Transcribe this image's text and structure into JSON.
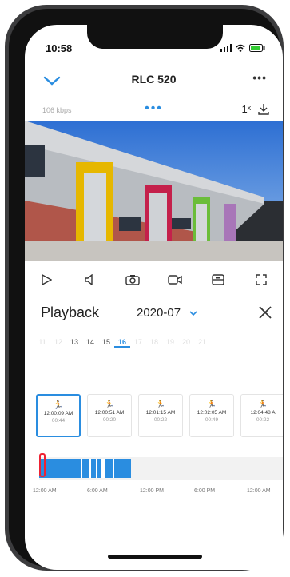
{
  "status": {
    "time": "10:58"
  },
  "header": {
    "title": "RLC 520",
    "more": "•••"
  },
  "subbar": {
    "speed": "106 kbps",
    "ratio": "1ˣ"
  },
  "playback": {
    "title": "Playback",
    "month": "2020-07"
  },
  "days": [
    "11",
    "12",
    "13",
    "14",
    "15",
    "16",
    "17",
    "18",
    "19",
    "20",
    "21"
  ],
  "days_active": [
    "13",
    "14",
    "15",
    "16"
  ],
  "selected_day": "16",
  "clips": [
    {
      "time": "12:00:09 AM",
      "duration": "00:44"
    },
    {
      "time": "12:00:51 AM",
      "duration": "00:20"
    },
    {
      "time": "12:01:15 AM",
      "duration": "00:22"
    },
    {
      "time": "12:02:05 AM",
      "duration": "00:49"
    },
    {
      "time": "12:04:48 A",
      "duration": "00:22"
    }
  ],
  "timeline_labels": [
    "12:00 AM",
    "6:00 AM",
    "12:00 PM",
    "6:00 PM",
    "12:00 AM"
  ],
  "colors": {
    "accent": "#2a8de0",
    "marker": "#e23333"
  }
}
